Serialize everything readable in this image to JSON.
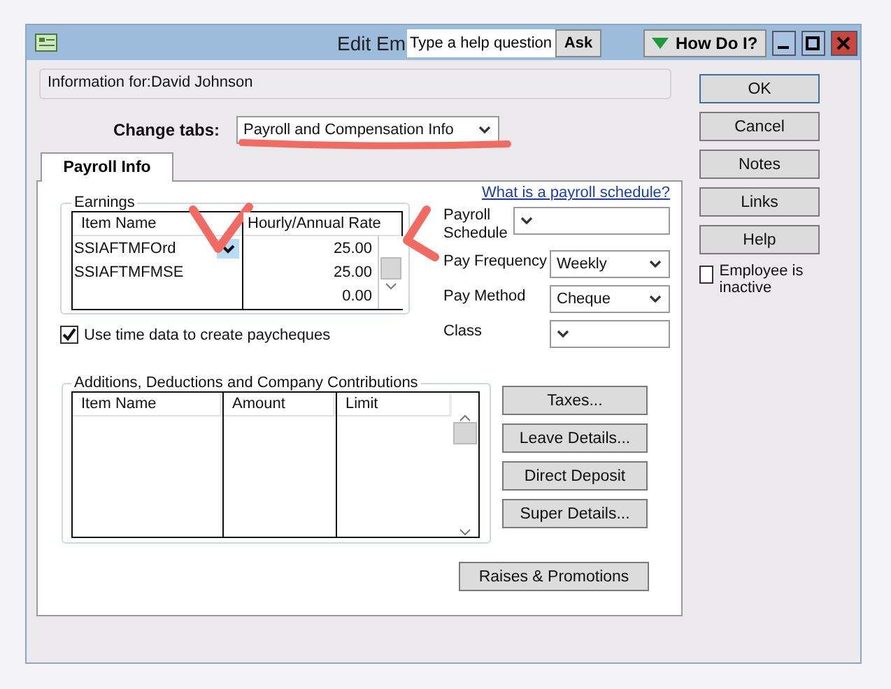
{
  "window": {
    "title": "Edit Em"
  },
  "help": {
    "placeholder": "Type a help question",
    "ask": "Ask",
    "how_do_i": "How Do I?"
  },
  "info_for": "Information for:David Johnson",
  "change_tabs": {
    "label": "Change tabs:",
    "value": "Payroll and Compensation Info"
  },
  "tabs": [
    {
      "label": "Payroll Info",
      "selected": true
    }
  ],
  "earnings": {
    "title": "Earnings",
    "columns": [
      "Item Name",
      "Hourly/Annual Rate"
    ],
    "rows": [
      {
        "item": "SSIAFTMFOrd",
        "rate": "25.00",
        "editing": true
      },
      {
        "item": "SSIAFTMFMSE",
        "rate": "25.00",
        "editing": false
      },
      {
        "rate": "0.00",
        "editing": false
      }
    ]
  },
  "use_time_data": {
    "label": "Use time data to create paycheques",
    "checked": true
  },
  "schedule_link": "What is a payroll schedule?",
  "fields": [
    {
      "label": "Payroll Schedule"
    },
    {
      "label": "Pay Frequency",
      "value": "Weekly"
    },
    {
      "label": "Pay Method",
      "value": "Cheque"
    },
    {
      "label": "Class"
    }
  ],
  "additions": {
    "title": "Additions, Deductions and Company Contributions",
    "columns": [
      "Item Name",
      "Amount",
      "Limit"
    ]
  },
  "side_buttons": [
    "Taxes...",
    "Leave Details...",
    "Direct Deposit",
    "Super Details..."
  ],
  "raises_button": "Raises & Promotions",
  "dialog_buttons": [
    {
      "label": "OK",
      "default": true
    },
    {
      "label": "Cancel",
      "default": false
    },
    {
      "label": "Notes",
      "default": false
    },
    {
      "label": "Links",
      "default": false
    },
    {
      "label": "Help",
      "default": false
    }
  ],
  "employee_inactive": {
    "label": "Employee is inactive",
    "checked": false
  }
}
